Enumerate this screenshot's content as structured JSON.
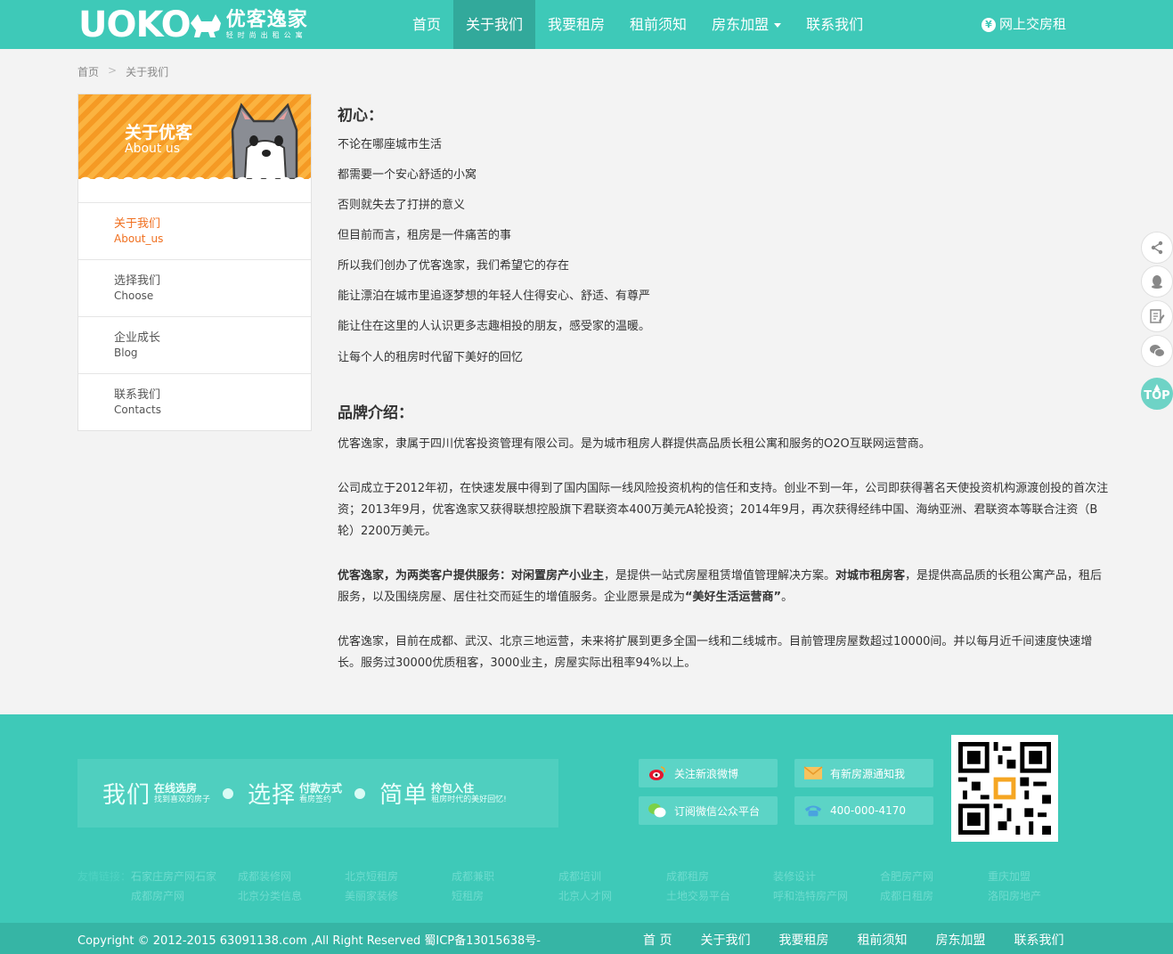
{
  "header": {
    "logo_mark": "UOKO",
    "logo_cn": "优客逸家",
    "logo_sub": "轻时尚出租公寓",
    "nav": [
      "首页",
      "关于我们",
      "我要租房",
      "租前须知",
      "房东加盟",
      "联系我们"
    ],
    "pay_icon": "¥",
    "pay_label": "网上交房租"
  },
  "breadcrumb": {
    "home": "首页",
    "sep": ">",
    "current": "关于我们"
  },
  "sidebar": {
    "banner_title": "关于优客",
    "banner_sub": "About us",
    "items": [
      {
        "cn": "关于我们",
        "en": "About_us"
      },
      {
        "cn": "选择我们",
        "en": "Choose"
      },
      {
        "cn": "企业成长",
        "en": "Blog"
      },
      {
        "cn": "联系我们",
        "en": "Contacts"
      }
    ]
  },
  "content": {
    "section1_title": "初心：",
    "section1_lines": [
      "不论在哪座城市生活",
      "都需要一个安心舒适的小窝",
      "否则就失去了打拼的意义",
      "但目前而言，租房是一件痛苦的事",
      "所以我们创办了优客逸家，我们希望它的存在",
      "能让漂泊在城市里追逐梦想的年轻人住得安心、舒适、有尊严",
      "能让住在这里的人认识更多志趣相投的朋友，感受家的温暖。",
      "让每个人的租房时代留下美好的回忆"
    ],
    "section2_title": "品牌介绍：",
    "p1": "优客逸家，隶属于四川优客投资管理有限公司。是为城市租房人群提供高品质长租公寓和服务的O2O互联网运营商。",
    "p2": "公司成立于2012年初，在快速发展中得到了国内国际一线风险投资机构的信任和支持。创业不到一年，公司即获得著名天使投资机构源渡创投的首次注资；2013年9月，优客逸家又获得联想控股旗下君联资本400万美元A轮投资；2014年9月，再次获得经纬中国、海纳亚洲、君联资本等联合注资（B轮）2200万美元。",
    "p3_b1": "优客逸家，为两类客户提供服务：对闲置房产小业主",
    "p3_t1": "，是提供一站式房屋租赁增值管理解决方案。",
    "p3_b2": "对城市租房客",
    "p3_t2": "，是提供高品质的长租公寓产品，租后服务，以及围绕房屋、居住社交而延生的增值服务。企业愿景是成为",
    "p3_b3": "“美好生活运营商”",
    "p3_t3": "。",
    "p4": "优客逸家，目前在成都、武汉、北京三地运营，未来将扩展到更多全国一线和二线城市。目前管理房屋数超过10000间。并以每月近千间速度快速增长。服务过30000优质租客，3000业主，房屋实际出租率94%以上。"
  },
  "float_bar": {
    "icons": [
      "share-icon",
      "qq-icon",
      "edit-icon",
      "wechat-icon"
    ],
    "top_label": "TOP"
  },
  "footer": {
    "slogan": [
      {
        "big": "我们",
        "s1": "在线选房",
        "s2": "找到喜欢的房子"
      },
      {
        "big": "选择",
        "s1": "付款方式",
        "s2": "看房签约"
      },
      {
        "big": "简单",
        "s1": "拎包入住",
        "s2": "租房时代的美好回忆!"
      }
    ],
    "buttons": {
      "weibo": "关注新浪微博",
      "notify": "有新房源通知我",
      "wechat": "订阅微信公众平台",
      "phone": "400-000-4170"
    },
    "links_label": "友情链接：",
    "links_row1": [
      "石家庄房产网石家",
      "成都装修网",
      "北京短租房",
      "成都兼职",
      "成都培训",
      "成都租房",
      "装修设计",
      "合肥房产网",
      "重庆加盟"
    ],
    "links_row2": [
      "成都房产网",
      "北京分类信息",
      "美丽家装修",
      "短租房",
      "北京人才网",
      "土地交易平台",
      "呼和浩特房产网",
      "成都日租房",
      "洛阳房地产"
    ],
    "copyright": "Copyright © 2012-2015 63091138.com ,All Right Reserved 蜀ICP备13015638号-",
    "bottom_nav": [
      "首 页",
      "关于我们",
      "我要租房",
      "租前须知",
      "房东加盟",
      "联系我们"
    ]
  },
  "colors": {
    "brand": "#3ec9b8",
    "nav_active": "#32a99b",
    "accent_orange": "#f07020"
  }
}
